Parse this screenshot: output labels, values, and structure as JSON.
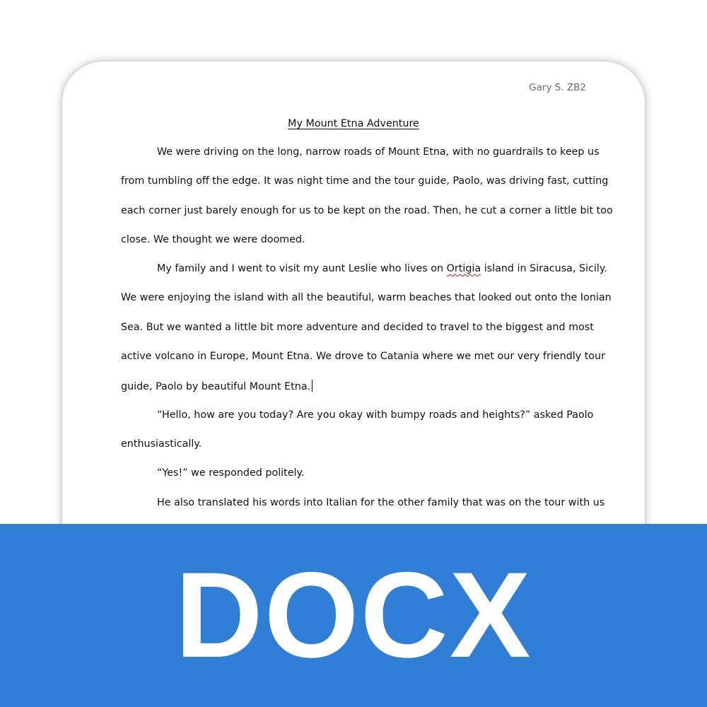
{
  "document": {
    "author": "Gary S. ZB2",
    "title": "My Mount Etna Adventure",
    "lines": [
      "We were driving on the long, narrow roads of Mount Etna, with no guardrails to keep us",
      "from tumbling off the edge. It was night time and the tour guide, Paolo, was driving fast, cutting",
      "each corner just barely enough for us to be kept on the road. Then, he cut a corner a little bit too",
      "close. We thought we were doomed.",
      "My family and I went to visit my aunt Leslie who lives on",
      "Ortigia",
      "island in Siracusa, Sicily.",
      "We were enjoying the island with all the beautiful, warm beaches that looked out onto the Ionian",
      "Sea. But we wanted a little bit more adventure and decided to travel to the biggest and most",
      "active volcano in Europe, Mount Etna. We drove to Catania where we met our very friendly tour",
      "guide, Paolo by beautiful Mount Etna.",
      "“Hello, how are you today? Are you okay with bumpy roads and heights?” asked Paolo",
      "enthusiastically.",
      "“Yes!” we responded politely.",
      "He also translated his words into Italian for the other family that was on the tour with us"
    ]
  },
  "banner": {
    "label": "DOCX",
    "color": "#2f7fd6"
  }
}
